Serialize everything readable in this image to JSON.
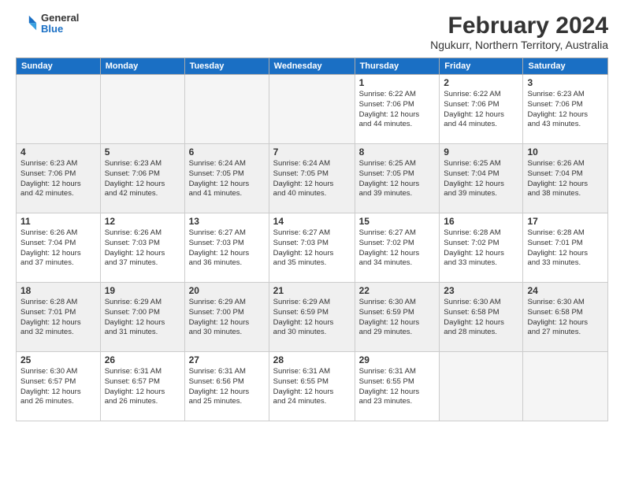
{
  "logo": {
    "general": "General",
    "blue": "Blue"
  },
  "title": {
    "month": "February 2024",
    "location": "Ngukurr, Northern Territory, Australia"
  },
  "headers": [
    "Sunday",
    "Monday",
    "Tuesday",
    "Wednesday",
    "Thursday",
    "Friday",
    "Saturday"
  ],
  "weeks": [
    {
      "shaded": false,
      "days": [
        {
          "num": "",
          "info": "",
          "empty": true
        },
        {
          "num": "",
          "info": "",
          "empty": true
        },
        {
          "num": "",
          "info": "",
          "empty": true
        },
        {
          "num": "",
          "info": "",
          "empty": true
        },
        {
          "num": "1",
          "info": "Sunrise: 6:22 AM\nSunset: 7:06 PM\nDaylight: 12 hours\nand 44 minutes."
        },
        {
          "num": "2",
          "info": "Sunrise: 6:22 AM\nSunset: 7:06 PM\nDaylight: 12 hours\nand 44 minutes."
        },
        {
          "num": "3",
          "info": "Sunrise: 6:23 AM\nSunset: 7:06 PM\nDaylight: 12 hours\nand 43 minutes."
        }
      ]
    },
    {
      "shaded": true,
      "days": [
        {
          "num": "4",
          "info": "Sunrise: 6:23 AM\nSunset: 7:06 PM\nDaylight: 12 hours\nand 42 minutes."
        },
        {
          "num": "5",
          "info": "Sunrise: 6:23 AM\nSunset: 7:06 PM\nDaylight: 12 hours\nand 42 minutes."
        },
        {
          "num": "6",
          "info": "Sunrise: 6:24 AM\nSunset: 7:05 PM\nDaylight: 12 hours\nand 41 minutes."
        },
        {
          "num": "7",
          "info": "Sunrise: 6:24 AM\nSunset: 7:05 PM\nDaylight: 12 hours\nand 40 minutes."
        },
        {
          "num": "8",
          "info": "Sunrise: 6:25 AM\nSunset: 7:05 PM\nDaylight: 12 hours\nand 39 minutes."
        },
        {
          "num": "9",
          "info": "Sunrise: 6:25 AM\nSunset: 7:04 PM\nDaylight: 12 hours\nand 39 minutes."
        },
        {
          "num": "10",
          "info": "Sunrise: 6:26 AM\nSunset: 7:04 PM\nDaylight: 12 hours\nand 38 minutes."
        }
      ]
    },
    {
      "shaded": false,
      "days": [
        {
          "num": "11",
          "info": "Sunrise: 6:26 AM\nSunset: 7:04 PM\nDaylight: 12 hours\nand 37 minutes."
        },
        {
          "num": "12",
          "info": "Sunrise: 6:26 AM\nSunset: 7:03 PM\nDaylight: 12 hours\nand 37 minutes."
        },
        {
          "num": "13",
          "info": "Sunrise: 6:27 AM\nSunset: 7:03 PM\nDaylight: 12 hours\nand 36 minutes."
        },
        {
          "num": "14",
          "info": "Sunrise: 6:27 AM\nSunset: 7:03 PM\nDaylight: 12 hours\nand 35 minutes."
        },
        {
          "num": "15",
          "info": "Sunrise: 6:27 AM\nSunset: 7:02 PM\nDaylight: 12 hours\nand 34 minutes."
        },
        {
          "num": "16",
          "info": "Sunrise: 6:28 AM\nSunset: 7:02 PM\nDaylight: 12 hours\nand 33 minutes."
        },
        {
          "num": "17",
          "info": "Sunrise: 6:28 AM\nSunset: 7:01 PM\nDaylight: 12 hours\nand 33 minutes."
        }
      ]
    },
    {
      "shaded": true,
      "days": [
        {
          "num": "18",
          "info": "Sunrise: 6:28 AM\nSunset: 7:01 PM\nDaylight: 12 hours\nand 32 minutes."
        },
        {
          "num": "19",
          "info": "Sunrise: 6:29 AM\nSunset: 7:00 PM\nDaylight: 12 hours\nand 31 minutes."
        },
        {
          "num": "20",
          "info": "Sunrise: 6:29 AM\nSunset: 7:00 PM\nDaylight: 12 hours\nand 30 minutes."
        },
        {
          "num": "21",
          "info": "Sunrise: 6:29 AM\nSunset: 6:59 PM\nDaylight: 12 hours\nand 30 minutes."
        },
        {
          "num": "22",
          "info": "Sunrise: 6:30 AM\nSunset: 6:59 PM\nDaylight: 12 hours\nand 29 minutes."
        },
        {
          "num": "23",
          "info": "Sunrise: 6:30 AM\nSunset: 6:58 PM\nDaylight: 12 hours\nand 28 minutes."
        },
        {
          "num": "24",
          "info": "Sunrise: 6:30 AM\nSunset: 6:58 PM\nDaylight: 12 hours\nand 27 minutes."
        }
      ]
    },
    {
      "shaded": false,
      "days": [
        {
          "num": "25",
          "info": "Sunrise: 6:30 AM\nSunset: 6:57 PM\nDaylight: 12 hours\nand 26 minutes."
        },
        {
          "num": "26",
          "info": "Sunrise: 6:31 AM\nSunset: 6:57 PM\nDaylight: 12 hours\nand 26 minutes."
        },
        {
          "num": "27",
          "info": "Sunrise: 6:31 AM\nSunset: 6:56 PM\nDaylight: 12 hours\nand 25 minutes."
        },
        {
          "num": "28",
          "info": "Sunrise: 6:31 AM\nSunset: 6:55 PM\nDaylight: 12 hours\nand 24 minutes."
        },
        {
          "num": "29",
          "info": "Sunrise: 6:31 AM\nSunset: 6:55 PM\nDaylight: 12 hours\nand 23 minutes."
        },
        {
          "num": "",
          "info": "",
          "empty": true
        },
        {
          "num": "",
          "info": "",
          "empty": true
        }
      ]
    }
  ]
}
